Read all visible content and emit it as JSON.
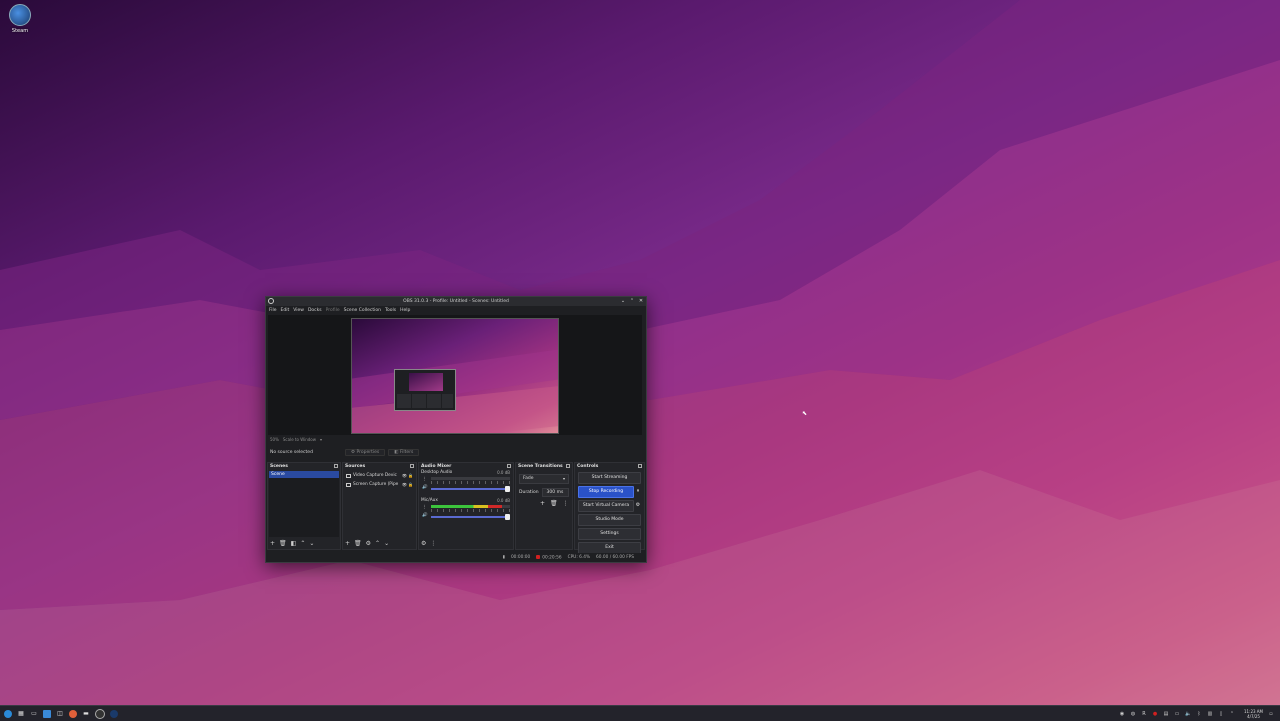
{
  "desktop": {
    "icons": [
      {
        "label": "Steam",
        "icon": "steam-icon"
      }
    ]
  },
  "window": {
    "title": "OBS 31.0.3 - Profile: Untitled - Scenes: Untitled",
    "controls": {
      "minimize": "⌄",
      "maximize": "⌃",
      "close": "✕"
    }
  },
  "menu": {
    "items": [
      "File",
      "Edit",
      "View",
      "Docks",
      "Profile",
      "Scene Collection",
      "Tools",
      "Help"
    ]
  },
  "source_toolbar": {
    "percent": "50%",
    "mode": "Scale to Window"
  },
  "properties_bar": {
    "no_source": "No source selected",
    "properties": "Properties",
    "filters": "Filters"
  },
  "scenes_dock": {
    "title": "Scenes",
    "items": [
      "Scene"
    ]
  },
  "sources_dock": {
    "title": "Sources",
    "items": [
      "Video Capture Devic",
      "Screen Capture (Pipe"
    ]
  },
  "mixer_dock": {
    "title": "Audio Mixer",
    "channels": [
      {
        "name": "Desktop Audio",
        "db": "0.0 dB",
        "level": 0.0
      },
      {
        "name": "Mic/Aux",
        "db": "0.0 dB",
        "level": 0.9
      }
    ]
  },
  "transitions_dock": {
    "title": "Scene Transitions",
    "type": "Fade",
    "duration_label": "Duration",
    "duration_value": "300 ms"
  },
  "controls_dock": {
    "title": "Controls",
    "start_streaming": "Start Streaming",
    "stop_recording": "Stop Recording",
    "start_virtual_camera": "Start Virtual Camera",
    "studio_mode": "Studio Mode",
    "settings": "Settings",
    "exit": "Exit"
  },
  "status": {
    "stream_time": "00:00:00",
    "rec_time": "00:20:56",
    "cpu": "CPU: 6.4%",
    "fps": "60.00 / 60.00 FPS"
  },
  "taskbar": {
    "time": "11:23 AM",
    "date": "4/7/25"
  },
  "colors": {
    "accent": "#2a52c8",
    "recording": "#d02020",
    "meter_green": "#3cc43c",
    "meter_yellow": "#d8c020",
    "meter_red": "#d02828"
  }
}
